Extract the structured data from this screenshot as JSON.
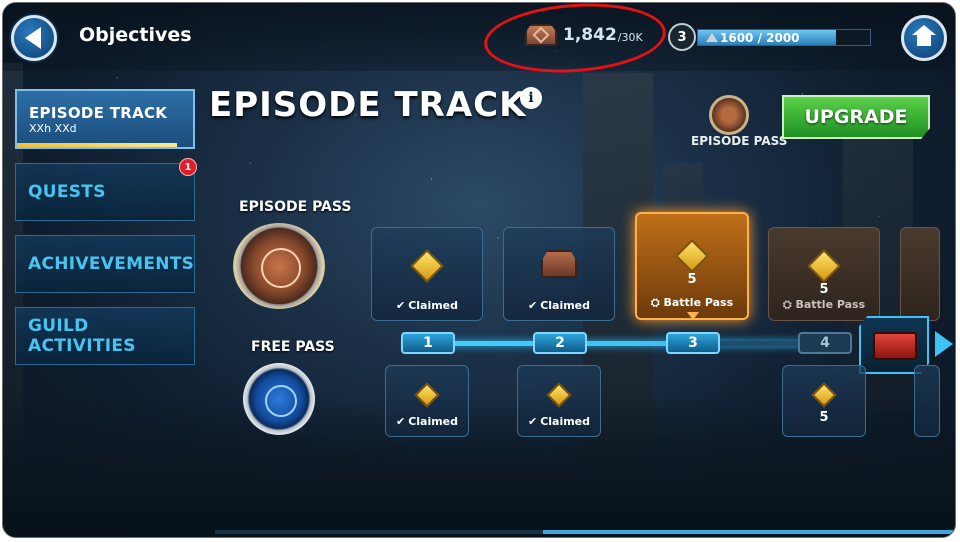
{
  "header": {
    "title": "Objectives",
    "currency": {
      "value": "1,842",
      "max": "/30K",
      "icon": "episode-crate-icon"
    },
    "level": "3",
    "xp": {
      "text": "1600 / 2000",
      "fraction": 0.8
    }
  },
  "sidebar": {
    "items": [
      {
        "label": "EPISODE TRACK",
        "sub": "XXh XXd",
        "active": true
      },
      {
        "label": "QUESTS",
        "badge": "1"
      },
      {
        "label": "ACHIVEVEMENTS"
      },
      {
        "label": "GUILD ACTIVITIES"
      }
    ]
  },
  "main": {
    "title": "EPISODE TRACK",
    "upgrade_label": "UPGRADE",
    "episode_pass_small_label": "EPISODE PASS",
    "episode_pass_label": "EPISODE PASS",
    "free_pass_label": "FREE PASS",
    "top_rewards": [
      {
        "status": "Claimed",
        "icon": "gem-icon"
      },
      {
        "status": "Claimed",
        "icon": "crate-icon"
      },
      {
        "qty": "5",
        "status": "Battle Pass",
        "icon": "gem-icon"
      },
      {
        "qty": "5",
        "status": "Battle Pass",
        "icon": "gem-icon"
      }
    ],
    "bottom_rewards": [
      {
        "status": "Claimed",
        "icon": "gem-icon"
      },
      {
        "status": "Claimed",
        "icon": "gem-icon"
      },
      {
        "qty": "5",
        "icon": "gem-icon"
      }
    ],
    "track_nodes": [
      "1",
      "2",
      "3",
      "4"
    ]
  },
  "colors": {
    "accent": "#49c3f0",
    "upgrade": "#2fa82f",
    "highlight": "#ffb24a",
    "annotation": "#e41212"
  }
}
